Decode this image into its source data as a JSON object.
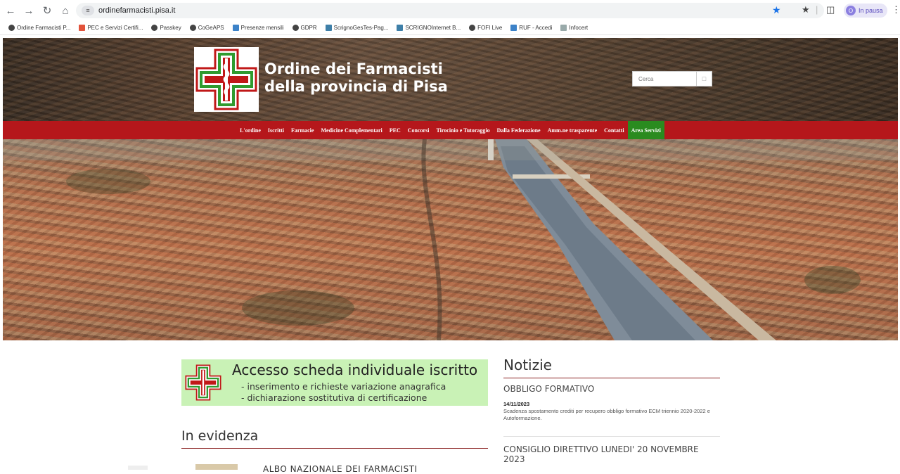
{
  "browser": {
    "url": "ordinefarmacisti.pisa.it",
    "profile_label": "In pausa",
    "bookmarks": [
      {
        "label": "Ordine Farmacisti P...",
        "icon": "globe-icon"
      },
      {
        "label": "PEC e Servizi Certifi...",
        "icon": "plus-icon"
      },
      {
        "label": "Passkey",
        "icon": "globe-icon"
      },
      {
        "label": "CoGeAPS",
        "icon": "globe-icon"
      },
      {
        "label": "Presenze mensili",
        "icon": "presenze-icon"
      },
      {
        "label": "GDPR",
        "icon": "globe-icon"
      },
      {
        "label": "ScrignoGesTes-Pag...",
        "icon": "scrigno-icon"
      },
      {
        "label": "SCRIGNOInternet B...",
        "icon": "scrigno-icon"
      },
      {
        "label": "FOFI Live",
        "icon": "globe-icon"
      },
      {
        "label": "RUF - Accedi",
        "icon": "ruf-icon"
      },
      {
        "label": "Infocert",
        "icon": "infocert-icon"
      }
    ]
  },
  "site": {
    "name_line1": "Ordine dei Farmacisti",
    "name_line2": "della provincia di Pisa",
    "search_placeholder": "Cerca",
    "nav": [
      "L'ordine",
      "Iscritti",
      "Farmacie",
      "Medicine Complementari",
      "PEC",
      "Concorsi",
      "Tirocinio e Tutoraggio",
      "Dalla Federazione",
      "Amm.ne trasparente",
      "Contatti",
      "Area Servizi"
    ],
    "active_nav": "Area Servizi",
    "colors": {
      "nav_red": "#b5171b",
      "active_green": "#2a8b1f",
      "banner_green": "#c9f2b6"
    }
  },
  "banner": {
    "title": "Accesso scheda individuale iscritto",
    "line1": "- inserimento e richieste variazione anagrafica",
    "line2": "- dichiarazione sostitutiva di certificazione"
  },
  "in_evidenza": {
    "title": "In evidenza",
    "first_item": "ALBO NAZIONALE DEI FARMACISTI"
  },
  "notizie": {
    "title": "Notizie",
    "items": [
      {
        "heading": "OBBLIGO FORMATIVO",
        "date": "14/11/2023",
        "text": "Scadenza spostamento crediti per recupero obbligo formativo ECM triennio 2020-2022 e Autoformazione."
      },
      {
        "heading_line1": "CONSIGLIO DIRETTIVO LUNEDI' 20 NOVEMBRE",
        "heading_line2": "2023"
      }
    ]
  }
}
